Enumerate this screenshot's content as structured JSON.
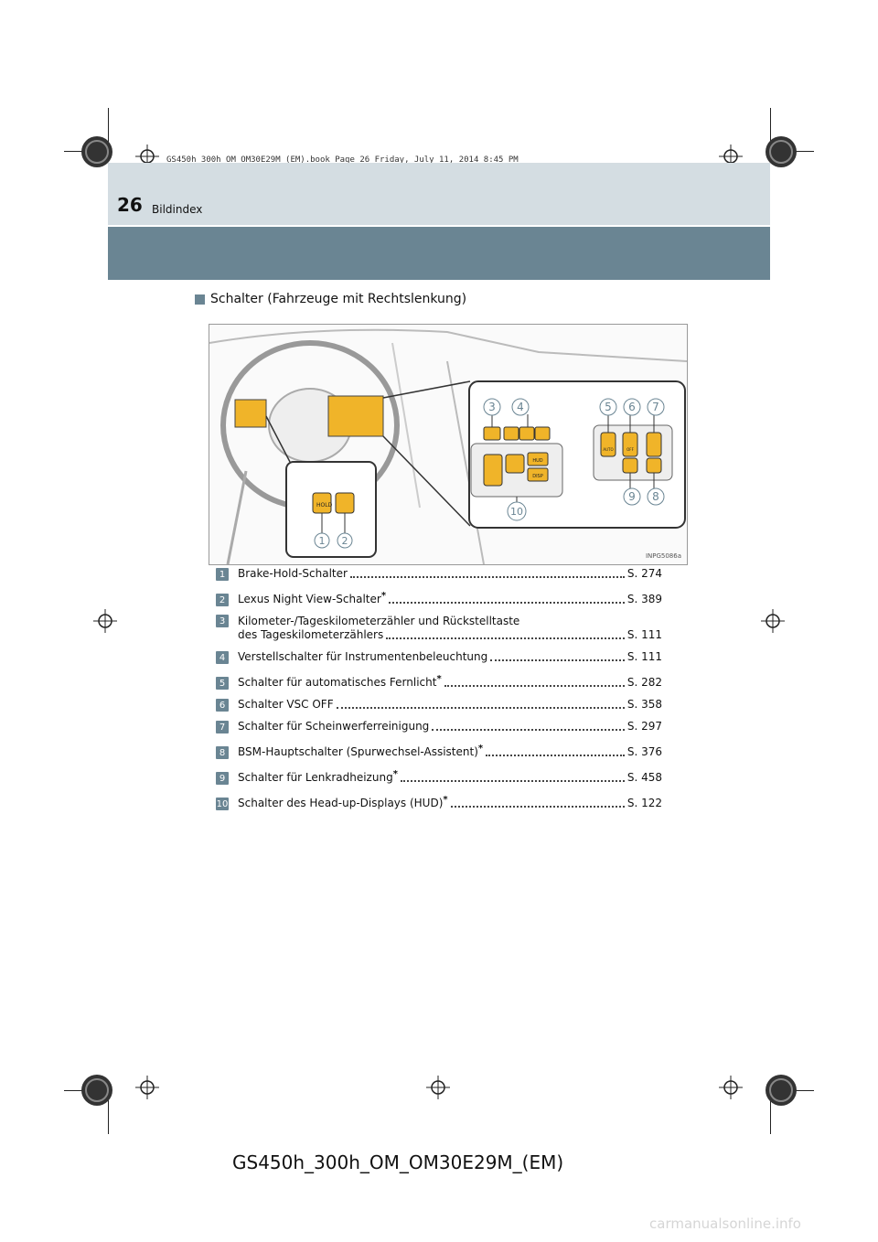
{
  "print_meta": "GS450h_300h_OM_OM30E29M_(EM).book  Page 26  Friday, July 11, 2014  8:45 PM",
  "header": {
    "page_number": "26",
    "section": "Bildindex"
  },
  "heading": "Schalter (Fahrzeuge mit Rechtslenkung)",
  "figure": {
    "code": "INPG5086a",
    "callouts": [
      "1",
      "2",
      "3",
      "4",
      "5",
      "6",
      "7",
      "8",
      "9",
      "10"
    ],
    "button_labels": {
      "hud": "HUD",
      "disp": "DISP",
      "auto": "AUTO",
      "off": "OFF",
      "hold": "HOLD"
    }
  },
  "items": [
    {
      "num": "1",
      "label": "Brake-Hold-Schalter",
      "star": "",
      "ref": "S. 274"
    },
    {
      "num": "2",
      "label": "Lexus Night View-Schalter",
      "star": "*",
      "ref": "S. 389"
    },
    {
      "num": "3",
      "label": "Kilometer-/Tageskilometerzähler und Rückstelltaste",
      "label2": "des Tageskilometerzählers",
      "star": "",
      "ref": "S. 111"
    },
    {
      "num": "4",
      "label": "Verstellschalter für Instrumentenbeleuchtung",
      "star": "",
      "ref": "S. 111"
    },
    {
      "num": "5",
      "label": "Schalter für automatisches Fernlicht",
      "star": "*",
      "ref": "S. 282"
    },
    {
      "num": "6",
      "label": "Schalter VSC OFF",
      "star": "",
      "ref": "S. 358"
    },
    {
      "num": "7",
      "label": "Schalter für Scheinwerferreinigung",
      "star": "",
      "ref": "S. 297"
    },
    {
      "num": "8",
      "label": "BSM-Hauptschalter (Spurwechsel-Assistent)",
      "star": "*",
      "ref": "S. 376"
    },
    {
      "num": "9",
      "label": "Schalter für Lenkradheizung",
      "star": "*",
      "ref": "S. 458"
    },
    {
      "num": "10",
      "label": "Schalter des Head-up-Displays (HUD)",
      "star": "*",
      "ref": "S. 122"
    }
  ],
  "footer": "GS450h_300h_OM_OM30E29M_(EM)",
  "watermark": "carmanualsonline.info",
  "colors": {
    "accent": "#6a8593",
    "header_light": "#d4dde2",
    "button_orange": "#f0b429"
  }
}
